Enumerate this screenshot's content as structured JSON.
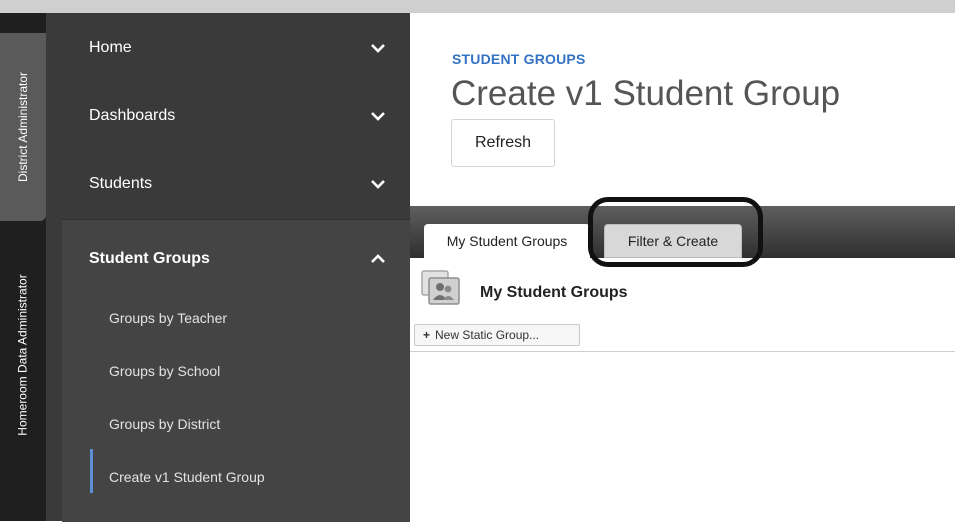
{
  "rail": {
    "tabs": [
      {
        "label": "District Administrator"
      },
      {
        "label": "Homeroom Data Administrator"
      }
    ]
  },
  "nav": {
    "items": [
      {
        "label": "Home",
        "icon": "chevron-down-icon"
      },
      {
        "label": "Dashboards",
        "icon": "chevron-down-icon"
      },
      {
        "label": "Students",
        "icon": "chevron-down-icon"
      }
    ],
    "group": {
      "label": "Student Groups",
      "icon": "chevron-up-icon",
      "subitems": [
        {
          "label": "Groups by Teacher"
        },
        {
          "label": "Groups by School"
        },
        {
          "label": "Groups by District"
        },
        {
          "label": "Create v1 Student Group",
          "selected": true
        }
      ]
    }
  },
  "header": {
    "breadcrumb": "STUDENT GROUPS",
    "title": "Create v1 Student Group",
    "refresh_label": "Refresh"
  },
  "tabs": [
    {
      "label": "My Student Groups",
      "active": true
    },
    {
      "label": "Filter & Create",
      "active": false
    }
  ],
  "section": {
    "title": "My Student Groups",
    "icon": "group-icon",
    "new_button_label": "New Static Group..."
  },
  "colors": {
    "accent": "#3372c4",
    "sidebar": "#3a3a3a",
    "rail": "#1f1f1f"
  }
}
